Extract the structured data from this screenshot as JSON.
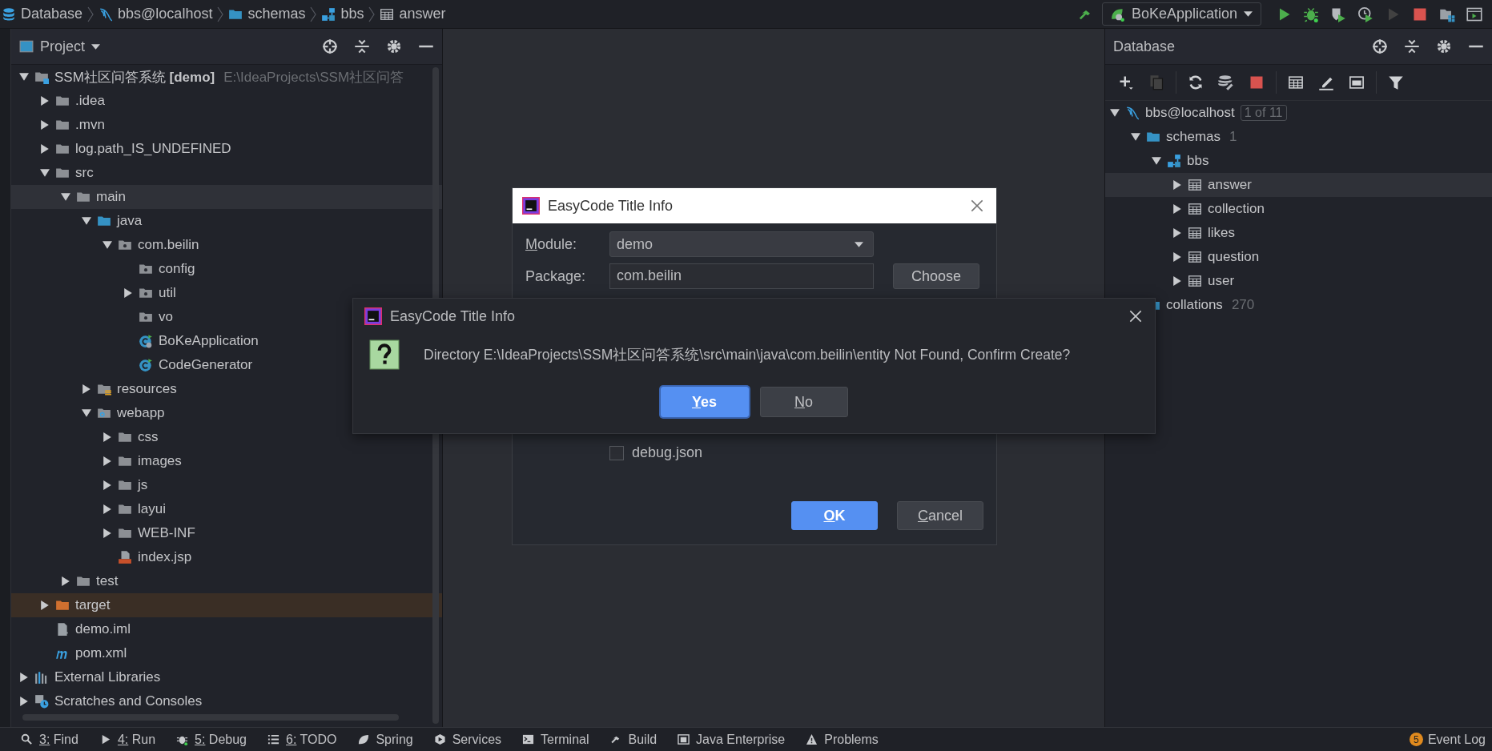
{
  "breadcrumbs": [
    {
      "label": "Database",
      "kind": "database"
    },
    {
      "label": "bbs@localhost",
      "kind": "mysql"
    },
    {
      "label": "schemas",
      "kind": "folder-db"
    },
    {
      "label": "bbs",
      "kind": "schema"
    },
    {
      "label": "answer",
      "kind": "table"
    }
  ],
  "run_toolbar": {
    "config": "BoKeApplication",
    "buttons": [
      {
        "kind": "build",
        "disabled": false
      },
      {
        "kind": "run",
        "disabled": false
      },
      {
        "kind": "debug",
        "disabled": false
      },
      {
        "kind": "coverage",
        "disabled": false
      },
      {
        "kind": "profile",
        "disabled": false
      },
      {
        "kind": "run",
        "disabled": true
      },
      {
        "kind": "stop",
        "disabled": false
      },
      {
        "kind": "structure",
        "disabled": false
      },
      {
        "kind": "window",
        "disabled": false
      }
    ]
  },
  "project_panel": {
    "title": "Project",
    "tree": [
      {
        "label": "SSM社区问答系统 **[demo]**",
        "path": "E:\\IdeaProjects\\SSM社区问答",
        "kind": "module",
        "expanded": true,
        "selected": false,
        "children": [
          {
            "label": ".idea",
            "kind": "folder",
            "expanded": false,
            "selected": false
          },
          {
            "label": ".mvn",
            "kind": "folder",
            "expanded": false,
            "selected": false
          },
          {
            "label": "log.path_IS_UNDEFINED",
            "kind": "folder",
            "expanded": false,
            "selected": false
          },
          {
            "label": "src",
            "kind": "folder",
            "expanded": true,
            "selected": false,
            "children": [
              {
                "label": "main",
                "kind": "folder",
                "expanded": true,
                "selected": true,
                "children": [
                  {
                    "label": "java",
                    "kind": "folder-source",
                    "expanded": true,
                    "selected": false,
                    "children": [
                      {
                        "label": "com.beilin",
                        "kind": "package",
                        "expanded": true,
                        "selected": false,
                        "children": [
                          {
                            "label": "config",
                            "kind": "package",
                            "selected": false
                          },
                          {
                            "label": "util",
                            "kind": "package",
                            "expanded": false,
                            "selected": false
                          },
                          {
                            "label": "vo",
                            "kind": "package",
                            "selected": false
                          },
                          {
                            "label": "BoKeApplication",
                            "kind": "class-app",
                            "selected": false
                          },
                          {
                            "label": "CodeGenerator",
                            "kind": "class",
                            "selected": false
                          }
                        ]
                      }
                    ]
                  },
                  {
                    "label": "resources",
                    "kind": "resources",
                    "expanded": false,
                    "selected": false
                  },
                  {
                    "label": "webapp",
                    "kind": "web",
                    "expanded": true,
                    "selected": false,
                    "children": [
                      {
                        "label": "css",
                        "kind": "folder",
                        "expanded": false,
                        "selected": false
                      },
                      {
                        "label": "images",
                        "kind": "folder",
                        "expanded": false,
                        "selected": false
                      },
                      {
                        "label": "js",
                        "kind": "folder",
                        "expanded": false,
                        "selected": false
                      },
                      {
                        "label": "layui",
                        "kind": "folder",
                        "expanded": false,
                        "selected": false
                      },
                      {
                        "label": "WEB-INF",
                        "kind": "folder",
                        "expanded": false,
                        "selected": false
                      },
                      {
                        "label": "index.jsp",
                        "kind": "jsp",
                        "selected": false
                      }
                    ]
                  }
                ]
              },
              {
                "label": "test",
                "kind": "folder",
                "expanded": false,
                "selected": false
              }
            ]
          },
          {
            "label": "target",
            "kind": "folder-excluded",
            "expanded": false,
            "selected": false
          },
          {
            "label": "demo.iml",
            "kind": "iml",
            "selected": false
          },
          {
            "label": "pom.xml",
            "kind": "maven",
            "selected": false
          }
        ]
      },
      {
        "label": "External Libraries",
        "kind": "libraries",
        "expanded": false,
        "selected": false
      },
      {
        "label": "Scratches and Consoles",
        "kind": "scratches",
        "expanded": false,
        "selected": false
      }
    ]
  },
  "database_panel": {
    "title": "Database",
    "toolbar": [
      {
        "kind": "add",
        "disabled": false
      },
      {
        "kind": "copy",
        "disabled": true
      },
      {
        "kind": "refresh",
        "disabled": false
      },
      {
        "kind": "tools",
        "disabled": false
      },
      {
        "kind": "stop",
        "disabled": false
      },
      {
        "kind": "table",
        "disabled": false
      },
      {
        "kind": "edit",
        "disabled": false
      },
      {
        "kind": "console",
        "disabled": false
      },
      {
        "kind": "filter",
        "disabled": false
      }
    ],
    "tree": [
      {
        "label": "bbs@localhost",
        "badge": "1 of 11",
        "kind": "mysql",
        "expanded": true,
        "selected": false,
        "children": [
          {
            "label": "schemas",
            "count": "1",
            "kind": "folder-db",
            "expanded": true,
            "selected": false,
            "children": [
              {
                "label": "bbs",
                "kind": "schema",
                "expanded": true,
                "selected": false,
                "children": [
                  {
                    "label": "answer",
                    "kind": "table",
                    "expanded": false,
                    "selected": true
                  },
                  {
                    "label": "collection",
                    "kind": "table",
                    "expanded": false,
                    "selected": false
                  },
                  {
                    "label": "likes",
                    "kind": "table",
                    "expanded": false,
                    "selected": false
                  },
                  {
                    "label": "question",
                    "kind": "table",
                    "expanded": false,
                    "selected": false
                  },
                  {
                    "label": "user",
                    "kind": "table",
                    "expanded": false,
                    "selected": false
                  }
                ]
              }
            ]
          },
          {
            "label": "collations",
            "count": "270",
            "kind": "folder-db",
            "selected": false
          }
        ]
      }
    ]
  },
  "back_dialog": {
    "title": "EasyCode Title Info",
    "fields": [
      {
        "label": "Module:",
        "mnemonic": true,
        "kind": "combo",
        "value": "demo"
      },
      {
        "label": "Package:",
        "mnemonic": false,
        "kind": "text",
        "value": "com.beilin",
        "button": "Choose"
      }
    ],
    "checkboxes": [
      {
        "label": "debug.json",
        "checked": false
      }
    ],
    "buttons": [
      {
        "label": "OK",
        "mnemonic": true,
        "default": true
      },
      {
        "label": "Cancel",
        "mnemonic": true,
        "default": false
      }
    ]
  },
  "front_dialog": {
    "title": "EasyCode Title Info",
    "message": "Directory E:\\IdeaProjects\\SSM社区问答系统\\src\\main\\java\\com.beilin\\entity Not Found, Confirm Create?",
    "buttons": [
      {
        "label": "Yes",
        "mnemonic": true,
        "default": true
      },
      {
        "label": "No",
        "mnemonic": true,
        "default": false
      }
    ]
  },
  "tool_windows": [
    {
      "label": "3: Find",
      "kind": "find",
      "mnemonic": true
    },
    {
      "label": "4: Run",
      "kind": "run",
      "mnemonic": true
    },
    {
      "label": "5: Debug",
      "kind": "debug",
      "mnemonic": true
    },
    {
      "label": "6: TODO",
      "kind": "todo",
      "mnemonic": true
    },
    {
      "label": "Spring",
      "kind": "spring",
      "mnemonic": false
    },
    {
      "label": "Services",
      "kind": "services",
      "mnemonic": false
    },
    {
      "label": "Terminal",
      "kind": "terminal",
      "mnemonic": false
    },
    {
      "label": "Build",
      "kind": "build",
      "mnemonic": false
    },
    {
      "label": "Java Enterprise",
      "kind": "enterprise",
      "mnemonic": false
    },
    {
      "label": "Problems",
      "kind": "problems",
      "mnemonic": false
    }
  ],
  "event_log": {
    "label": "Event Log",
    "badge": "5"
  }
}
